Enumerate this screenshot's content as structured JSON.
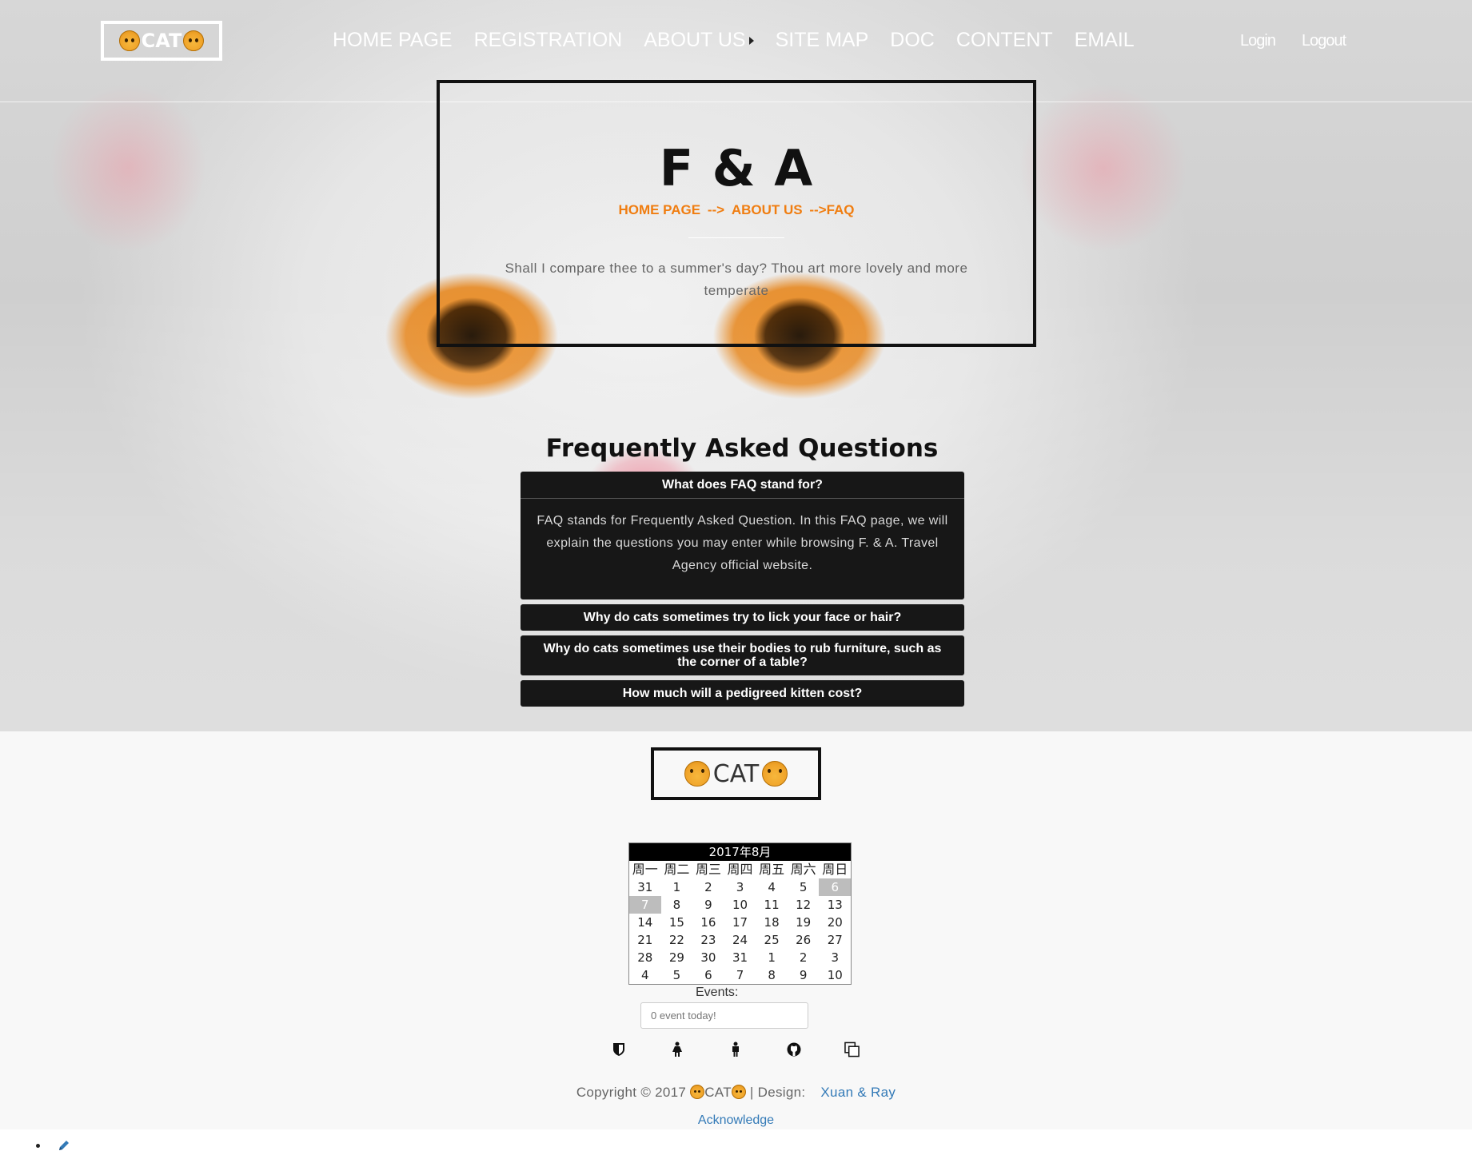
{
  "header": {
    "logo_text": "CAT",
    "nav": [
      {
        "label": "HOME PAGE"
      },
      {
        "label": "REGISTRATION"
      },
      {
        "label": "ABOUT US"
      },
      {
        "label": "SITE MAP"
      },
      {
        "label": "DOC"
      },
      {
        "label": "CONTENT"
      },
      {
        "label": "EMAIL"
      }
    ],
    "login": "Login",
    "logout": "Logout"
  },
  "hero": {
    "title": "F & A",
    "breadcrumb": {
      "home": "HOME PAGE",
      "sep1": "-->",
      "about": "ABOUT US",
      "current": "-->FAQ"
    },
    "description": "Shall I compare thee to a summer's day? Thou art more lovely and more temperate"
  },
  "faq": {
    "heading": "Frequently Asked Questions",
    "items": [
      {
        "question": "What does FAQ stand for?",
        "answer": "FAQ stands for Frequently Asked Question. In this FAQ page, we will explain the questions you may enter while browsing F. & A. Travel Agency official website."
      },
      {
        "question": "Why do cats sometimes try to lick your face or hair?"
      },
      {
        "question": "Why do cats sometimes use their bodies to rub furniture, such as the corner of a table?"
      },
      {
        "question": "How much will a pedigreed kitten cost?"
      }
    ]
  },
  "footer": {
    "logo_text": "CAT",
    "calendar": {
      "title": "2017年8月",
      "weekdays": [
        "周一",
        "周二",
        "周三",
        "周四",
        "周五",
        "周六",
        "周日"
      ],
      "weeks": [
        [
          "31",
          "1",
          "2",
          "3",
          "4",
          "5",
          "6"
        ],
        [
          "7",
          "8",
          "9",
          "10",
          "11",
          "12",
          "13"
        ],
        [
          "14",
          "15",
          "16",
          "17",
          "18",
          "19",
          "20"
        ],
        [
          "21",
          "22",
          "23",
          "24",
          "25",
          "26",
          "27"
        ],
        [
          "28",
          "29",
          "30",
          "31",
          "1",
          "2",
          "3"
        ],
        [
          "4",
          "5",
          "6",
          "7",
          "8",
          "9",
          "10"
        ]
      ],
      "highlighted": [
        "0-6",
        "1-0"
      ]
    },
    "events_label": "Events:",
    "events_placeholder": "0 event today!",
    "social_icons": [
      "shield-icon",
      "female-icon",
      "male-icon",
      "github-icon",
      "copy-icon"
    ],
    "copyright_prefix": "Copyright © 2017",
    "copyright_brand": "CAT",
    "design_label": "| Design:",
    "designers": "Xuan & Ray",
    "acknowledge": "Acknowledge"
  },
  "colors": {
    "accent": "#f07d10",
    "faq_bg": "#171717",
    "link": "#337ab7"
  }
}
